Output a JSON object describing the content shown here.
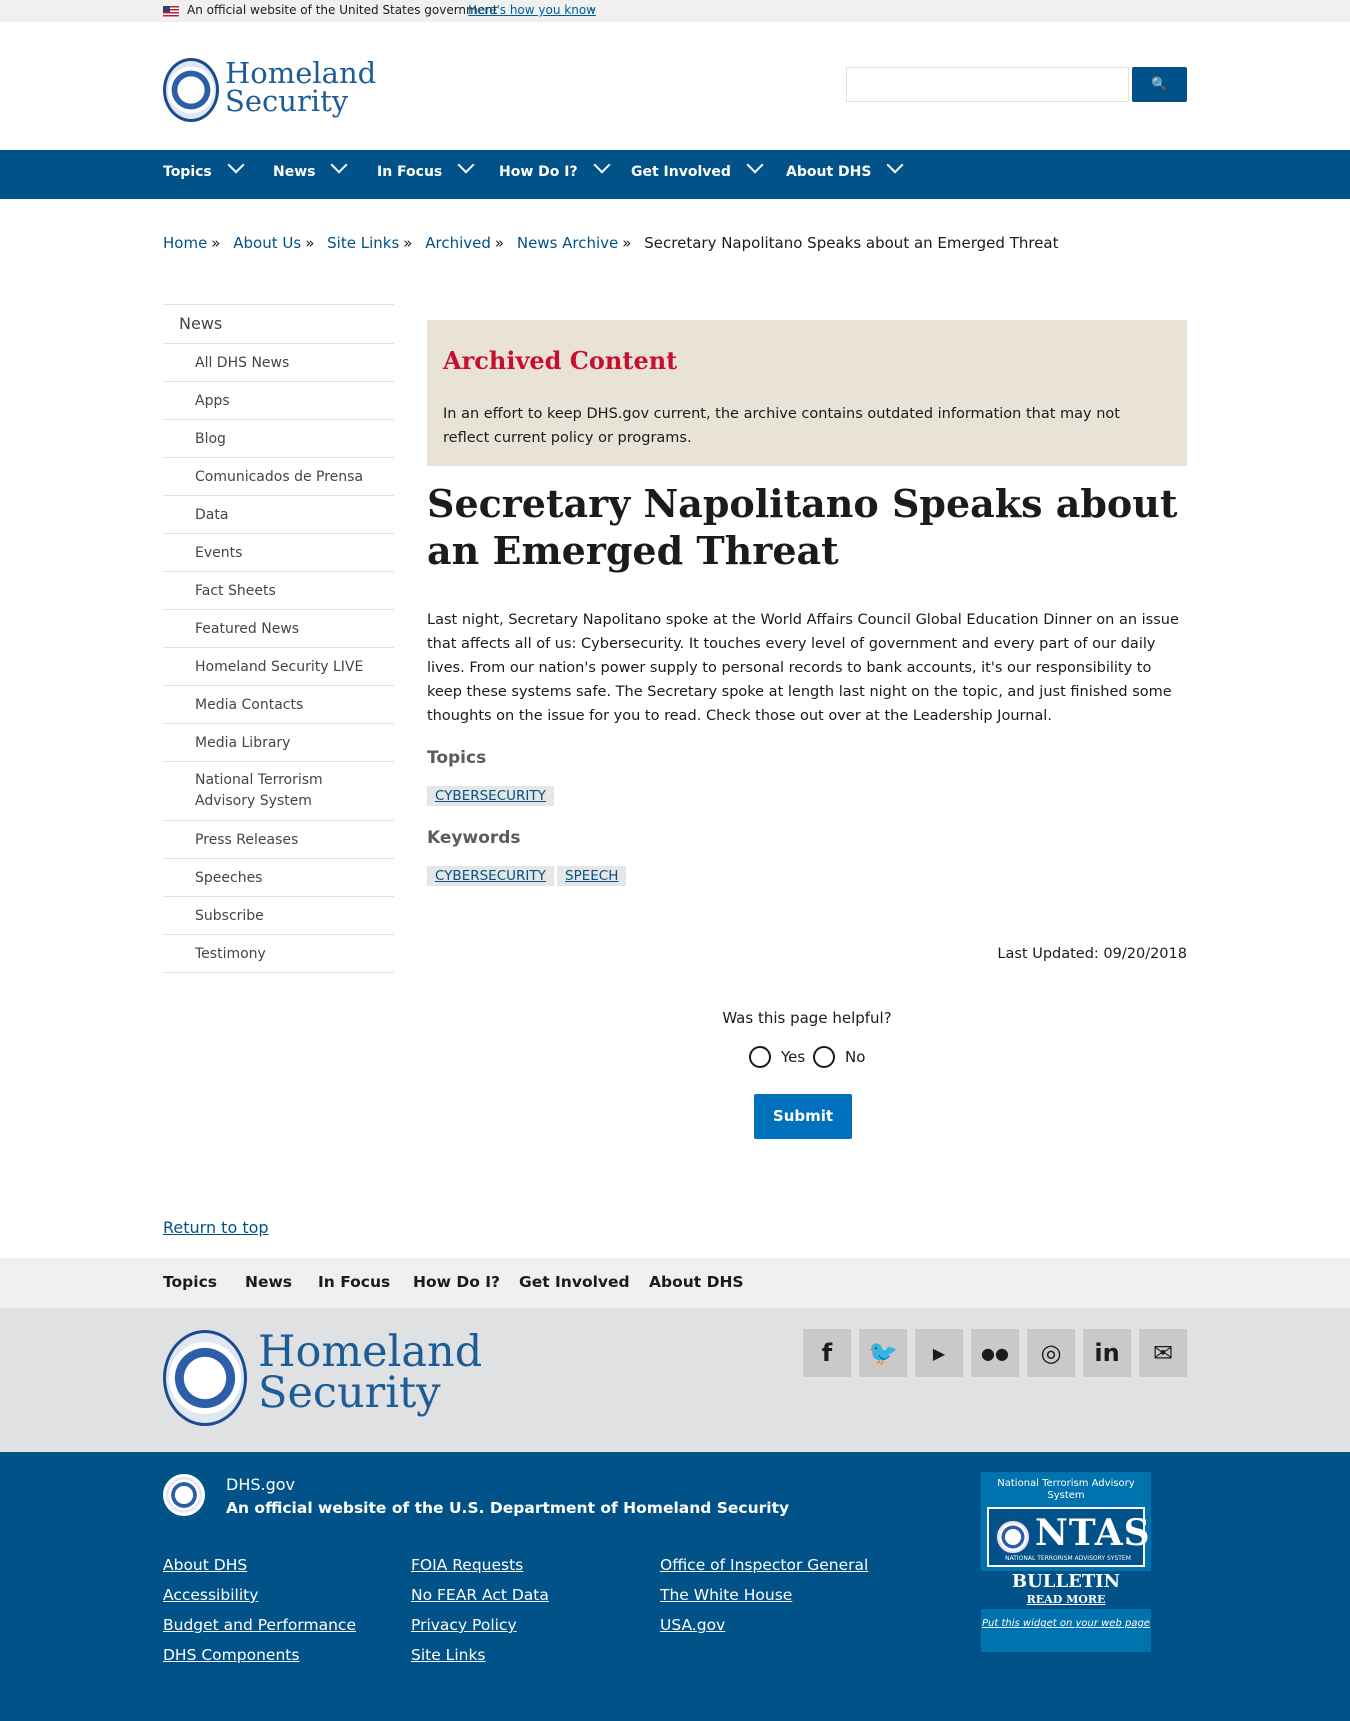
{
  "gov_banner": {
    "text": "An official website of the United States government",
    "link": "Here's how you know"
  },
  "header": {
    "logo_line1": "Homeland",
    "logo_line2": "Security",
    "search_placeholder": ""
  },
  "main_nav": [
    {
      "label": "Topics"
    },
    {
      "label": "News"
    },
    {
      "label": "In Focus"
    },
    {
      "label": "How Do I?"
    },
    {
      "label": "Get Involved"
    },
    {
      "label": "About DHS"
    }
  ],
  "breadcrumb": {
    "links": [
      "Home",
      "About Us",
      "Site Links",
      "Archived",
      "News Archive"
    ],
    "current": "Secretary Napolitano Speaks about an Emerged Threat",
    "separator": "»"
  },
  "sidebar": {
    "heading": "News",
    "items": [
      "All DHS News",
      "Apps",
      "Blog",
      "Comunicados de Prensa",
      "Data",
      "Events",
      "Fact Sheets",
      "Featured News",
      "Homeland Security LIVE",
      "Media Contacts",
      "Media Library",
      "National Terrorism Advisory System",
      "Press Releases",
      "Speeches",
      "Subscribe",
      "Testimony"
    ]
  },
  "archive": {
    "title": "Archived Content",
    "text": "In an effort to keep DHS.gov current, the archive contains outdated information that may not reflect current policy or programs."
  },
  "article": {
    "title": "Secretary Napolitano Speaks about an Emerged Threat",
    "body": "Last night, Secretary Napolitano spoke at the World Affairs Council Global Education Dinner on an issue that affects all of us: Cybersecurity. It touches every level of government and every part of our daily lives. From our nation's power supply to personal records to bank accounts, it's our responsibility to keep these systems safe. The Secretary spoke at length last night on the topic, and just finished some thoughts on the issue for you to read. Check those out over at the Leadership Journal.",
    "topics_label": "Topics",
    "topics": [
      "CYBERSECURITY"
    ],
    "keywords_label": "Keywords",
    "keywords": [
      "CYBERSECURITY",
      "SPEECH"
    ],
    "last_updated": "Last Updated: 09/20/2018"
  },
  "feedback": {
    "question": "Was this page helpful?",
    "yes": "Yes",
    "no": "No",
    "submit": "Submit"
  },
  "return_to_top": "Return to top",
  "footer_nav": [
    "Topics",
    "News",
    "In Focus",
    "How Do I?",
    "Get Involved",
    "About DHS"
  ],
  "footer_logo": {
    "line1": "Homeland",
    "line2": "Security"
  },
  "social": [
    {
      "name": "facebook-icon",
      "glyph": "f"
    },
    {
      "name": "twitter-icon",
      "glyph": "🐦"
    },
    {
      "name": "youtube-icon",
      "glyph": "▶"
    },
    {
      "name": "flickr-icon",
      "glyph": "●●"
    },
    {
      "name": "instagram-icon",
      "glyph": "◎"
    },
    {
      "name": "linkedin-icon",
      "glyph": "in"
    },
    {
      "name": "email-icon",
      "glyph": "✉"
    }
  ],
  "footer": {
    "site": "DHS.gov",
    "official_prefix": "An official website of the",
    "official_link": "U.S. Department of Homeland Security",
    "links_col1": [
      "About DHS",
      "Accessibility",
      "Budget and Performance",
      "DHS Components"
    ],
    "links_col2": [
      "FOIA Requests",
      "No FEAR Act Data",
      "Privacy Policy",
      "Site Links"
    ],
    "links_col3": [
      "Office of Inspector General",
      "The White House",
      "USA.gov"
    ]
  },
  "ntas": {
    "caption": "National Terrorism Advisory System",
    "logo": "NTAS",
    "logo_sub": "NATIONAL TERRORISM ADVISORY SYSTEM",
    "bulletin": "BULLETIN",
    "read_more": "READ MORE",
    "widget": "Put this widget on your web page"
  },
  "colors": {
    "primary_blue": "#005288",
    "archive_red": "#c8102e",
    "archive_bg": "#e8e3d6",
    "submit_blue": "#0071bc"
  }
}
